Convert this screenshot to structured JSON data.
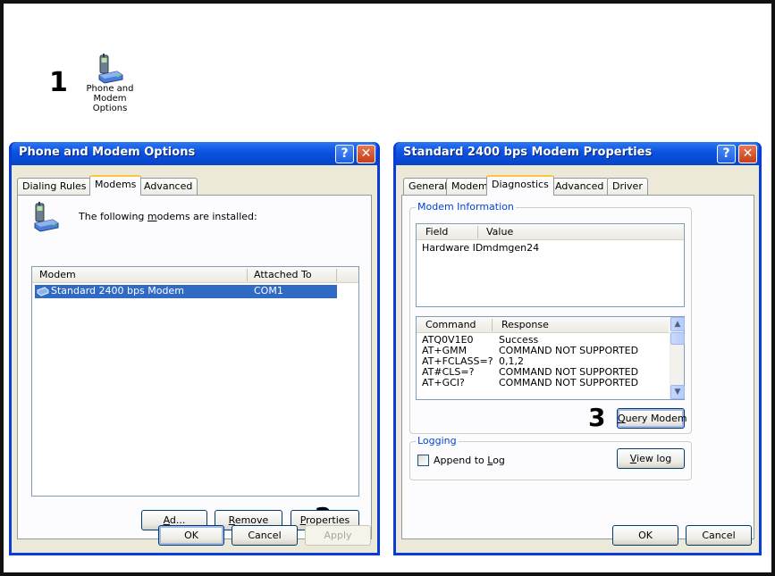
{
  "steps": {
    "one": "1",
    "two": "2",
    "three": "3"
  },
  "desktop_icon": {
    "icon": "phone-modem-icon",
    "line1": "Phone and",
    "line2": "Modem",
    "line3": "Options"
  },
  "left_window": {
    "title": "Phone and Modem Options",
    "help": "?",
    "close": "✕",
    "tabs": [
      "Dialing Rules",
      "Modems",
      "Advanced"
    ],
    "active_tab": "Modems",
    "intro": {
      "pre": "The following ",
      "key": "m",
      "post": "odems are  installed:"
    },
    "columns": [
      "Modem",
      "Attached To"
    ],
    "rows": [
      {
        "modem": "Standard  2400 bps Modem",
        "port": "COM1",
        "selected": true
      }
    ],
    "buttons": {
      "add": {
        "key": "A",
        "rest": "d",
        "tail": "d..."
      },
      "remove": {
        "key": "R",
        "rest": "emove"
      },
      "properties": {
        "key": "P",
        "rest": "roperties"
      },
      "ok": "OK",
      "cancel": "Cancel",
      "apply": "Apply"
    }
  },
  "right_window": {
    "title": "Standard  2400 bps Modem Properties",
    "help": "?",
    "close": "✕",
    "tabs": [
      "General",
      "Modem",
      "Diagnostics",
      "Advanced",
      "Driver"
    ],
    "active_tab": "Diagnostics",
    "modem_info": {
      "group_label": "Modem Information",
      "columns": [
        "Field",
        "Value"
      ],
      "rows": [
        {
          "field": "Hardware ID",
          "value": "mdmgen24"
        }
      ]
    },
    "responses": {
      "columns": [
        "Command",
        "Response"
      ],
      "rows": [
        {
          "command": "ATQ0V1E0",
          "response": "Success"
        },
        {
          "command": "AT+GMM",
          "response": "COMMAND NOT SUPPORTED"
        },
        {
          "command": "AT+FCLASS=?",
          "response": "0,1,2"
        },
        {
          "command": "AT#CLS=?",
          "response": "COMMAND NOT SUPPORTED"
        },
        {
          "command": "AT+GCI?",
          "response": "COMMAND NOT SUPPORTED"
        }
      ]
    },
    "query_button": {
      "key": "Q",
      "rest": "uery Modem"
    },
    "logging": {
      "group_label": "Logging",
      "append": {
        "pre": "Append to ",
        "key": "L",
        "post": "og"
      },
      "append_checked": false,
      "view_log": {
        "key": "V",
        "rest": "iew log"
      }
    },
    "buttons": {
      "ok": "OK",
      "cancel": "Cancel"
    }
  },
  "colors": {
    "title_blue": "#0a52e0",
    "dialog_face": "#ece9d8",
    "selection": "#316ac5",
    "group_label": "#0046d5",
    "close_red": "#c63e1b"
  }
}
